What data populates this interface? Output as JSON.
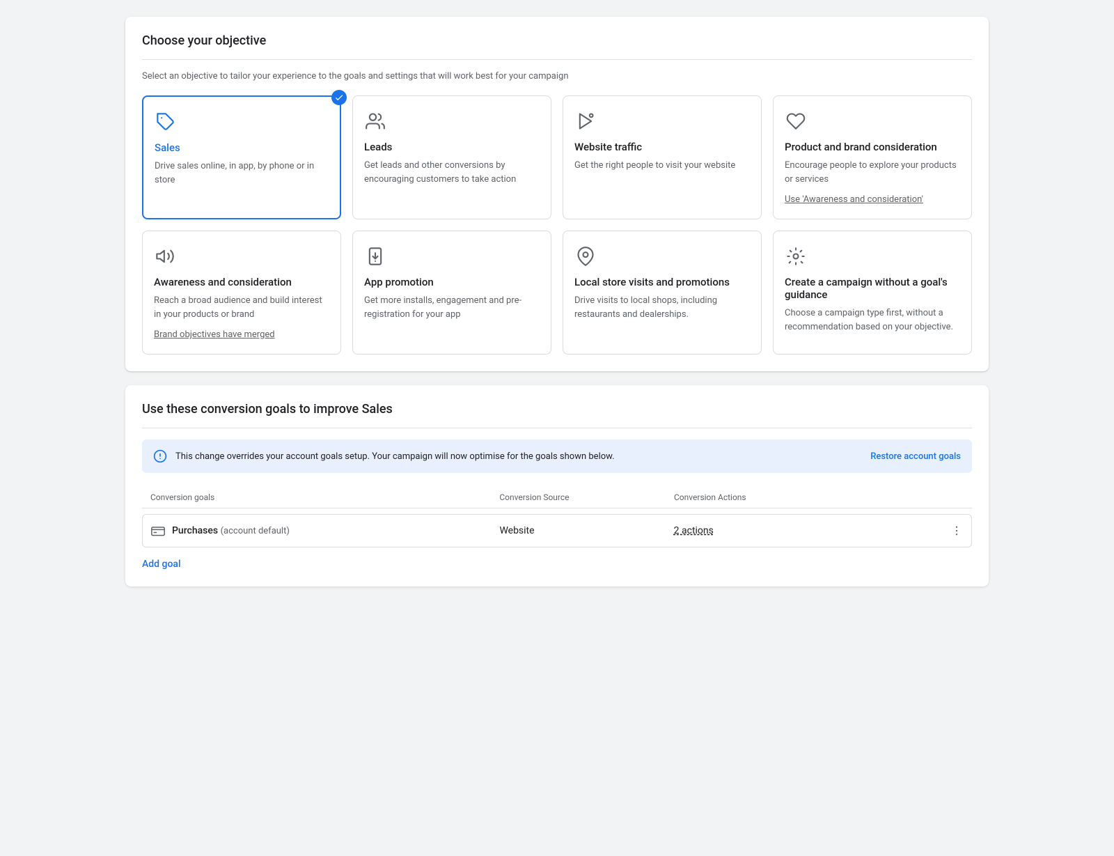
{
  "page": {
    "title": "Choose your objective"
  },
  "objective_section": {
    "title": "Choose your objective",
    "subtitle": "Select an objective to tailor your experience to the goals and settings that will work best for your campaign"
  },
  "objectives": [
    {
      "id": "sales",
      "title": "Sales",
      "description": "Drive sales online, in app, by phone or in store",
      "selected": true,
      "icon": "tag",
      "link": null
    },
    {
      "id": "leads",
      "title": "Leads",
      "description": "Get leads and other conversions by encouraging customers to take action",
      "selected": false,
      "icon": "people",
      "link": null
    },
    {
      "id": "website-traffic",
      "title": "Website traffic",
      "description": "Get the right people to visit your website",
      "selected": false,
      "icon": "cursor",
      "link": null
    },
    {
      "id": "product-brand",
      "title": "Product and brand consideration",
      "description": "Encourage people to explore your products or services",
      "selected": false,
      "icon": "heart",
      "link": "Use 'Awareness and consideration'"
    },
    {
      "id": "awareness",
      "title": "Awareness and consideration",
      "description": "Reach a broad audience and build interest in your products or brand",
      "selected": false,
      "icon": "megaphone",
      "link": "Brand objectives have merged"
    },
    {
      "id": "app-promotion",
      "title": "App promotion",
      "description": "Get more installs, engagement and pre-registration for your app",
      "selected": false,
      "icon": "phone-download",
      "link": null
    },
    {
      "id": "local-store",
      "title": "Local store visits and promotions",
      "description": "Drive visits to local shops, including restaurants and dealerships.",
      "selected": false,
      "icon": "location",
      "link": null
    },
    {
      "id": "no-goal",
      "title": "Create a campaign without a goal's guidance",
      "description": "Choose a campaign type first, without a recommendation based on your objective.",
      "selected": false,
      "icon": "gear",
      "link": null
    }
  ],
  "conversion_section": {
    "title": "Use these conversion goals to improve Sales",
    "banner_text": "This change overrides your account goals setup. Your campaign will now optimise for the goals shown below.",
    "banner_link": "Restore account goals",
    "table_headers": {
      "goals": "Conversion goals",
      "source": "Conversion Source",
      "actions": "Conversion Actions"
    },
    "rows": [
      {
        "goal": "Purchases",
        "goal_suffix": "(account default)",
        "source": "Website",
        "actions": "2 actions"
      }
    ],
    "add_goal_label": "Add goal"
  }
}
